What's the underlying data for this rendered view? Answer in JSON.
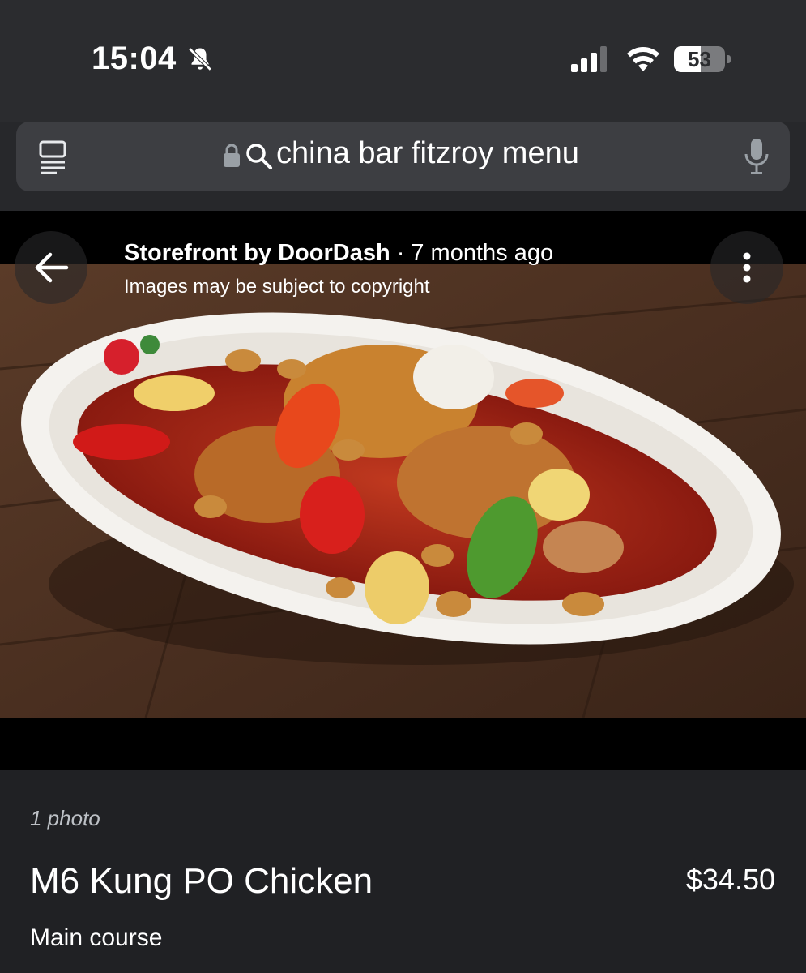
{
  "status_bar": {
    "time": "15:04",
    "battery_level": "53",
    "battery_fraction": 0.53
  },
  "search": {
    "query": "china bar fitzroy menu"
  },
  "viewer": {
    "source_name": "Storefront by DoorDash",
    "separator": "·",
    "age": "7 months ago",
    "copyright_notice": "Images may be subject to copyright"
  },
  "item": {
    "photo_count": "1 photo",
    "name": "M6 Kung PO Chicken",
    "price": "$34.50",
    "category": "Main course"
  },
  "icons": [
    "bell-off-icon",
    "signal-icon",
    "wifi-icon",
    "battery-icon",
    "reader-mode-icon",
    "lock-icon",
    "search-icon",
    "microphone-icon",
    "back-arrow-icon",
    "more-vert-icon"
  ],
  "colors": {
    "status_bg": "#2b2c2f",
    "search_box_bg": "#3d3e42",
    "page_bg": "#202124",
    "viewer_bg": "#000000",
    "muted_text": "#bdc1c6"
  }
}
